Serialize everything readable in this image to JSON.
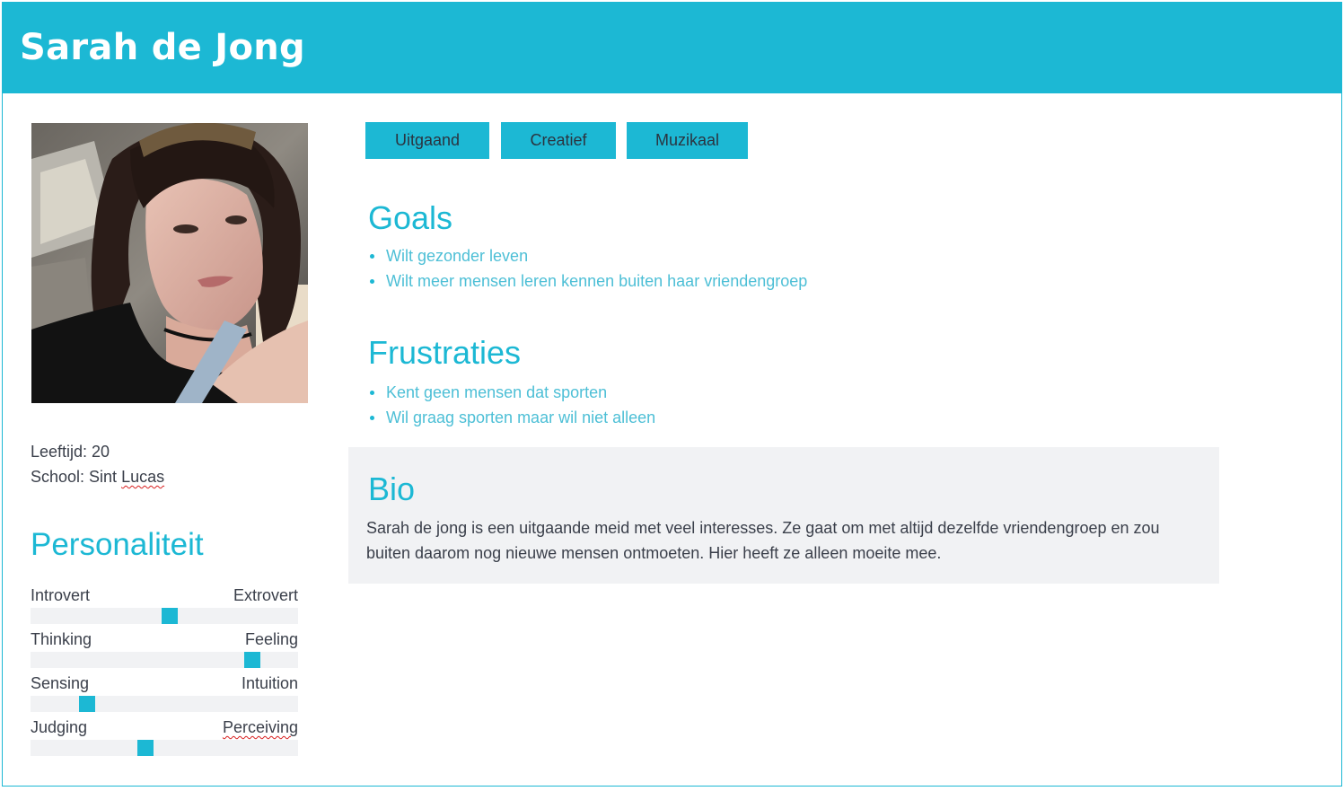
{
  "header": {
    "name": "Sarah de Jong"
  },
  "profile": {
    "photo_alt": "profile-photo",
    "age_label": "Leeftijd: 20",
    "school_prefix": "School: Sint ",
    "school_name": "Lucas"
  },
  "personality": {
    "title": "Personaliteit",
    "traits": [
      {
        "left": "Introvert",
        "right": "Extrovert",
        "value": 0.52
      },
      {
        "left": "Thinking",
        "right": "Feeling",
        "value": 0.83
      },
      {
        "left": "Sensing",
        "right": "Intuition",
        "value": 0.21
      },
      {
        "left": "Judging",
        "right": "Perceiving",
        "value": 0.43
      }
    ]
  },
  "tags": [
    "Uitgaand",
    "Creatief",
    "Muzikaal"
  ],
  "goals": {
    "title": "Goals",
    "items": [
      "Wilt gezonder leven",
      "Wilt meer mensen leren kennen buiten haar vriendengroep"
    ]
  },
  "frustrations": {
    "title": "Frustraties",
    "items": [
      "Kent geen mensen dat sporten",
      "Wil graag sporten maar wil niet alleen"
    ]
  },
  "bio": {
    "title": "Bio",
    "text": "Sarah de jong is een uitgaande meid met veel interesses. Ze gaat om met altijd dezelfde vriendengroep en zou buiten daarom nog nieuwe mensen ontmoeten. Hier heeft ze alleen moeite mee."
  },
  "colors": {
    "accent": "#1cb8d4",
    "track": "#f1f2f4",
    "text": "#3a3f4a"
  }
}
